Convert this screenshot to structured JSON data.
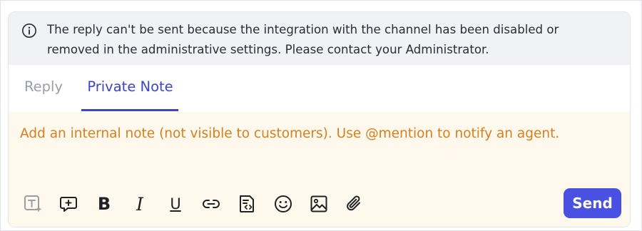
{
  "banner": {
    "icon": "info-icon",
    "message_line1": "The reply can't be sent because the integration with the channel has been disabled or",
    "message_line2": "removed in the administrative settings. Please contact your Administrator."
  },
  "tabs": [
    {
      "label": "Reply",
      "active": false
    },
    {
      "label": "Private Note",
      "active": true
    }
  ],
  "editor": {
    "placeholder": "Add an internal note (not visible to customers). Use @mention to notify an agent."
  },
  "toolbar": {
    "icons": [
      "text-ai-icon",
      "canned-response-icon",
      "bold-icon",
      "italic-icon",
      "underline-icon",
      "link-icon",
      "code-snippet-icon",
      "emoji-icon",
      "image-icon",
      "attachment-icon"
    ],
    "bold_glyph": "B",
    "italic_glyph": "I",
    "underline_glyph": "U",
    "send_label": "Send"
  },
  "colors": {
    "accent": "#3c45c7",
    "send_button": "#4a50e2",
    "banner_bg": "#f0f2f6",
    "editor_bg": "#fff8ec",
    "placeholder": "#d67f1f"
  }
}
